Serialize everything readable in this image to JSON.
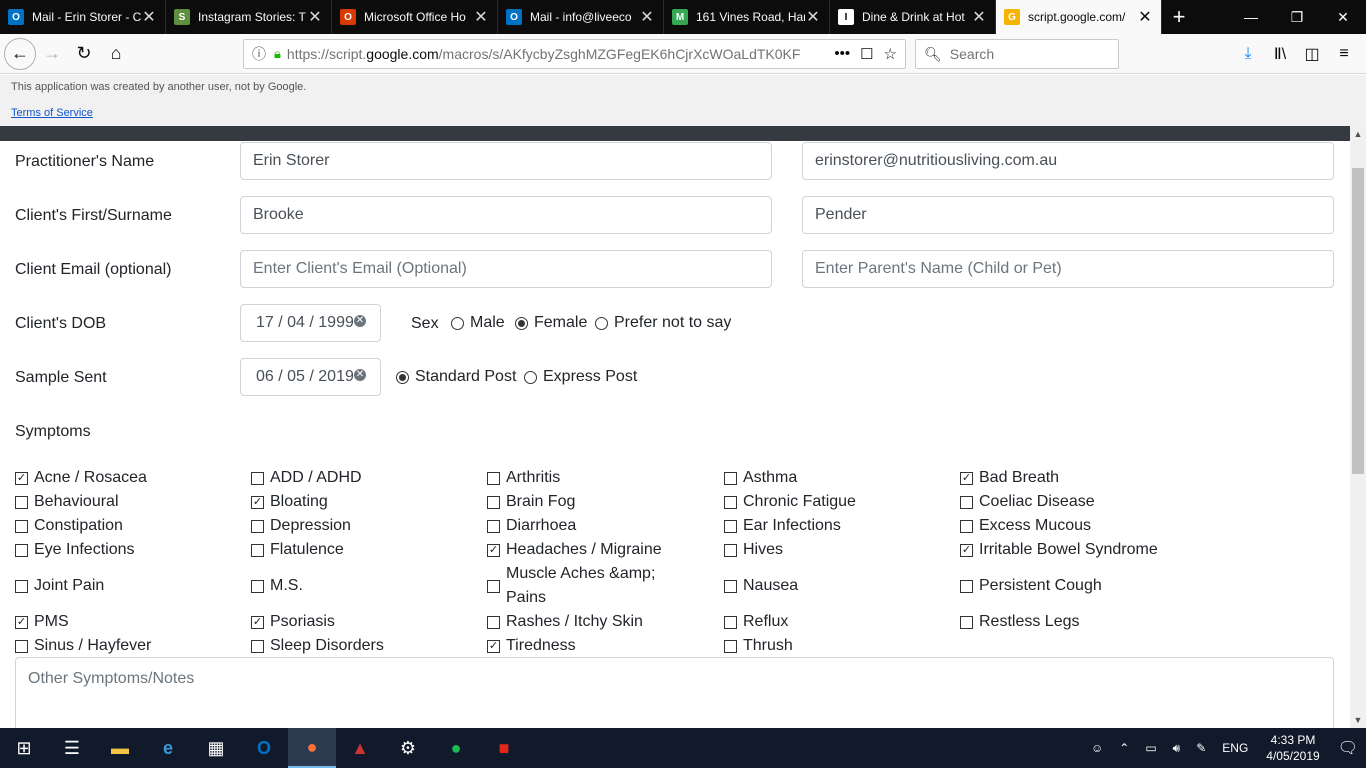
{
  "browser": {
    "tabs": [
      {
        "title": "Mail - Erin Storer - C",
        "icon": "outlook-icon",
        "color": "#0072c6",
        "glyph": "O"
      },
      {
        "title": "Instagram Stories: T",
        "icon": "shopify-icon",
        "color": "#5e8e3e",
        "glyph": "S"
      },
      {
        "title": "Microsoft Office Ho",
        "icon": "office-icon",
        "color": "#d83b01",
        "glyph": "O"
      },
      {
        "title": "Mail - info@liveeco",
        "icon": "outlook-icon",
        "color": "#0072c6",
        "glyph": "O"
      },
      {
        "title": "161 Vines Road, Har",
        "icon": "maps-icon",
        "color": "#34a853",
        "glyph": "M"
      },
      {
        "title": "Dine & Drink at Hot",
        "icon": "page-icon",
        "color": "#ffffff",
        "glyph": "I"
      },
      {
        "title": "script.google.com/",
        "icon": "apps-script-icon",
        "color": "#f4b400",
        "glyph": "G",
        "active": true
      }
    ],
    "url_prefix": "https://script.",
    "url_domain": "google.com",
    "url_rest": "/macros/s/AKfycbyZsghMZGFegEK6hCjrXcWOaLdTK0KF",
    "search_placeholder": "Search"
  },
  "banner": {
    "note": "This application was created by another user, not by Google.",
    "tos": "Terms of Service"
  },
  "form": {
    "practitioner": {
      "label": "Practitioner's Name",
      "name": "Erin Storer",
      "email": "erinstorer@nutritiousliving.com.au"
    },
    "client": {
      "label": "Client's First/Surname",
      "first": "Brooke",
      "surname": "Pender"
    },
    "client_email": {
      "label": "Client Email (optional)",
      "email_placeholder": "Enter Client's Email (Optional)",
      "parent_placeholder": "Enter Parent's Name (Child or Pet)"
    },
    "dob": {
      "label": "Client's DOB",
      "value": "17 / 04 / 1999"
    },
    "sex": {
      "label": "Sex",
      "options": [
        "Male",
        "Female",
        "Prefer not to say"
      ],
      "selected": "Female"
    },
    "sample": {
      "label": "Sample Sent",
      "date": "06 / 05 / 2019",
      "options": [
        "Standard Post",
        "Express Post"
      ],
      "selected": "Standard Post"
    },
    "symptoms_label": "Symptoms",
    "symptoms": [
      [
        {
          "label": "Acne / Rosacea",
          "checked": true
        },
        {
          "label": "ADD / ADHD",
          "checked": false
        },
        {
          "label": "Arthritis",
          "checked": false
        },
        {
          "label": "Asthma",
          "checked": false
        },
        {
          "label": "Bad Breath",
          "checked": true
        }
      ],
      [
        {
          "label": "Behavioural",
          "checked": false
        },
        {
          "label": "Bloating",
          "checked": true
        },
        {
          "label": "Brain Fog",
          "checked": false
        },
        {
          "label": "Chronic Fatigue",
          "checked": false
        },
        {
          "label": "Coeliac Disease",
          "checked": false
        }
      ],
      [
        {
          "label": "Constipation",
          "checked": false
        },
        {
          "label": "Depression",
          "checked": false
        },
        {
          "label": "Diarrhoea",
          "checked": false
        },
        {
          "label": "Ear Infections",
          "checked": false
        },
        {
          "label": "Excess Mucous",
          "checked": false
        }
      ],
      [
        {
          "label": "Eye Infections",
          "checked": false
        },
        {
          "label": "Flatulence",
          "checked": false
        },
        {
          "label": "Headaches / Migraine",
          "checked": true
        },
        {
          "label": "Hives",
          "checked": false
        },
        {
          "label": "Irritable Bowel Syndrome",
          "checked": true
        }
      ],
      [
        {
          "label": "Joint Pain",
          "checked": false
        },
        {
          "label": "M.S.",
          "checked": false
        },
        {
          "label": "Muscle Aches &amp; Pains",
          "checked": false
        },
        {
          "label": "Nausea",
          "checked": false
        },
        {
          "label": "Persistent Cough",
          "checked": false
        }
      ],
      [
        {
          "label": "PMS",
          "checked": true
        },
        {
          "label": "Psoriasis",
          "checked": true
        },
        {
          "label": "Rashes / Itchy Skin",
          "checked": false
        },
        {
          "label": "Reflux",
          "checked": false
        },
        {
          "label": "Restless Legs",
          "checked": false
        }
      ],
      [
        {
          "label": "Sinus / Hayfever",
          "checked": false
        },
        {
          "label": "Sleep Disorders",
          "checked": false
        },
        {
          "label": "Tiredness",
          "checked": true
        },
        {
          "label": "Thrush",
          "checked": false
        }
      ]
    ],
    "notes_placeholder": "Other Symptoms/Notes"
  },
  "taskbar": {
    "language": "ENG",
    "time": "4:33 PM",
    "date": "4/05/2019"
  }
}
